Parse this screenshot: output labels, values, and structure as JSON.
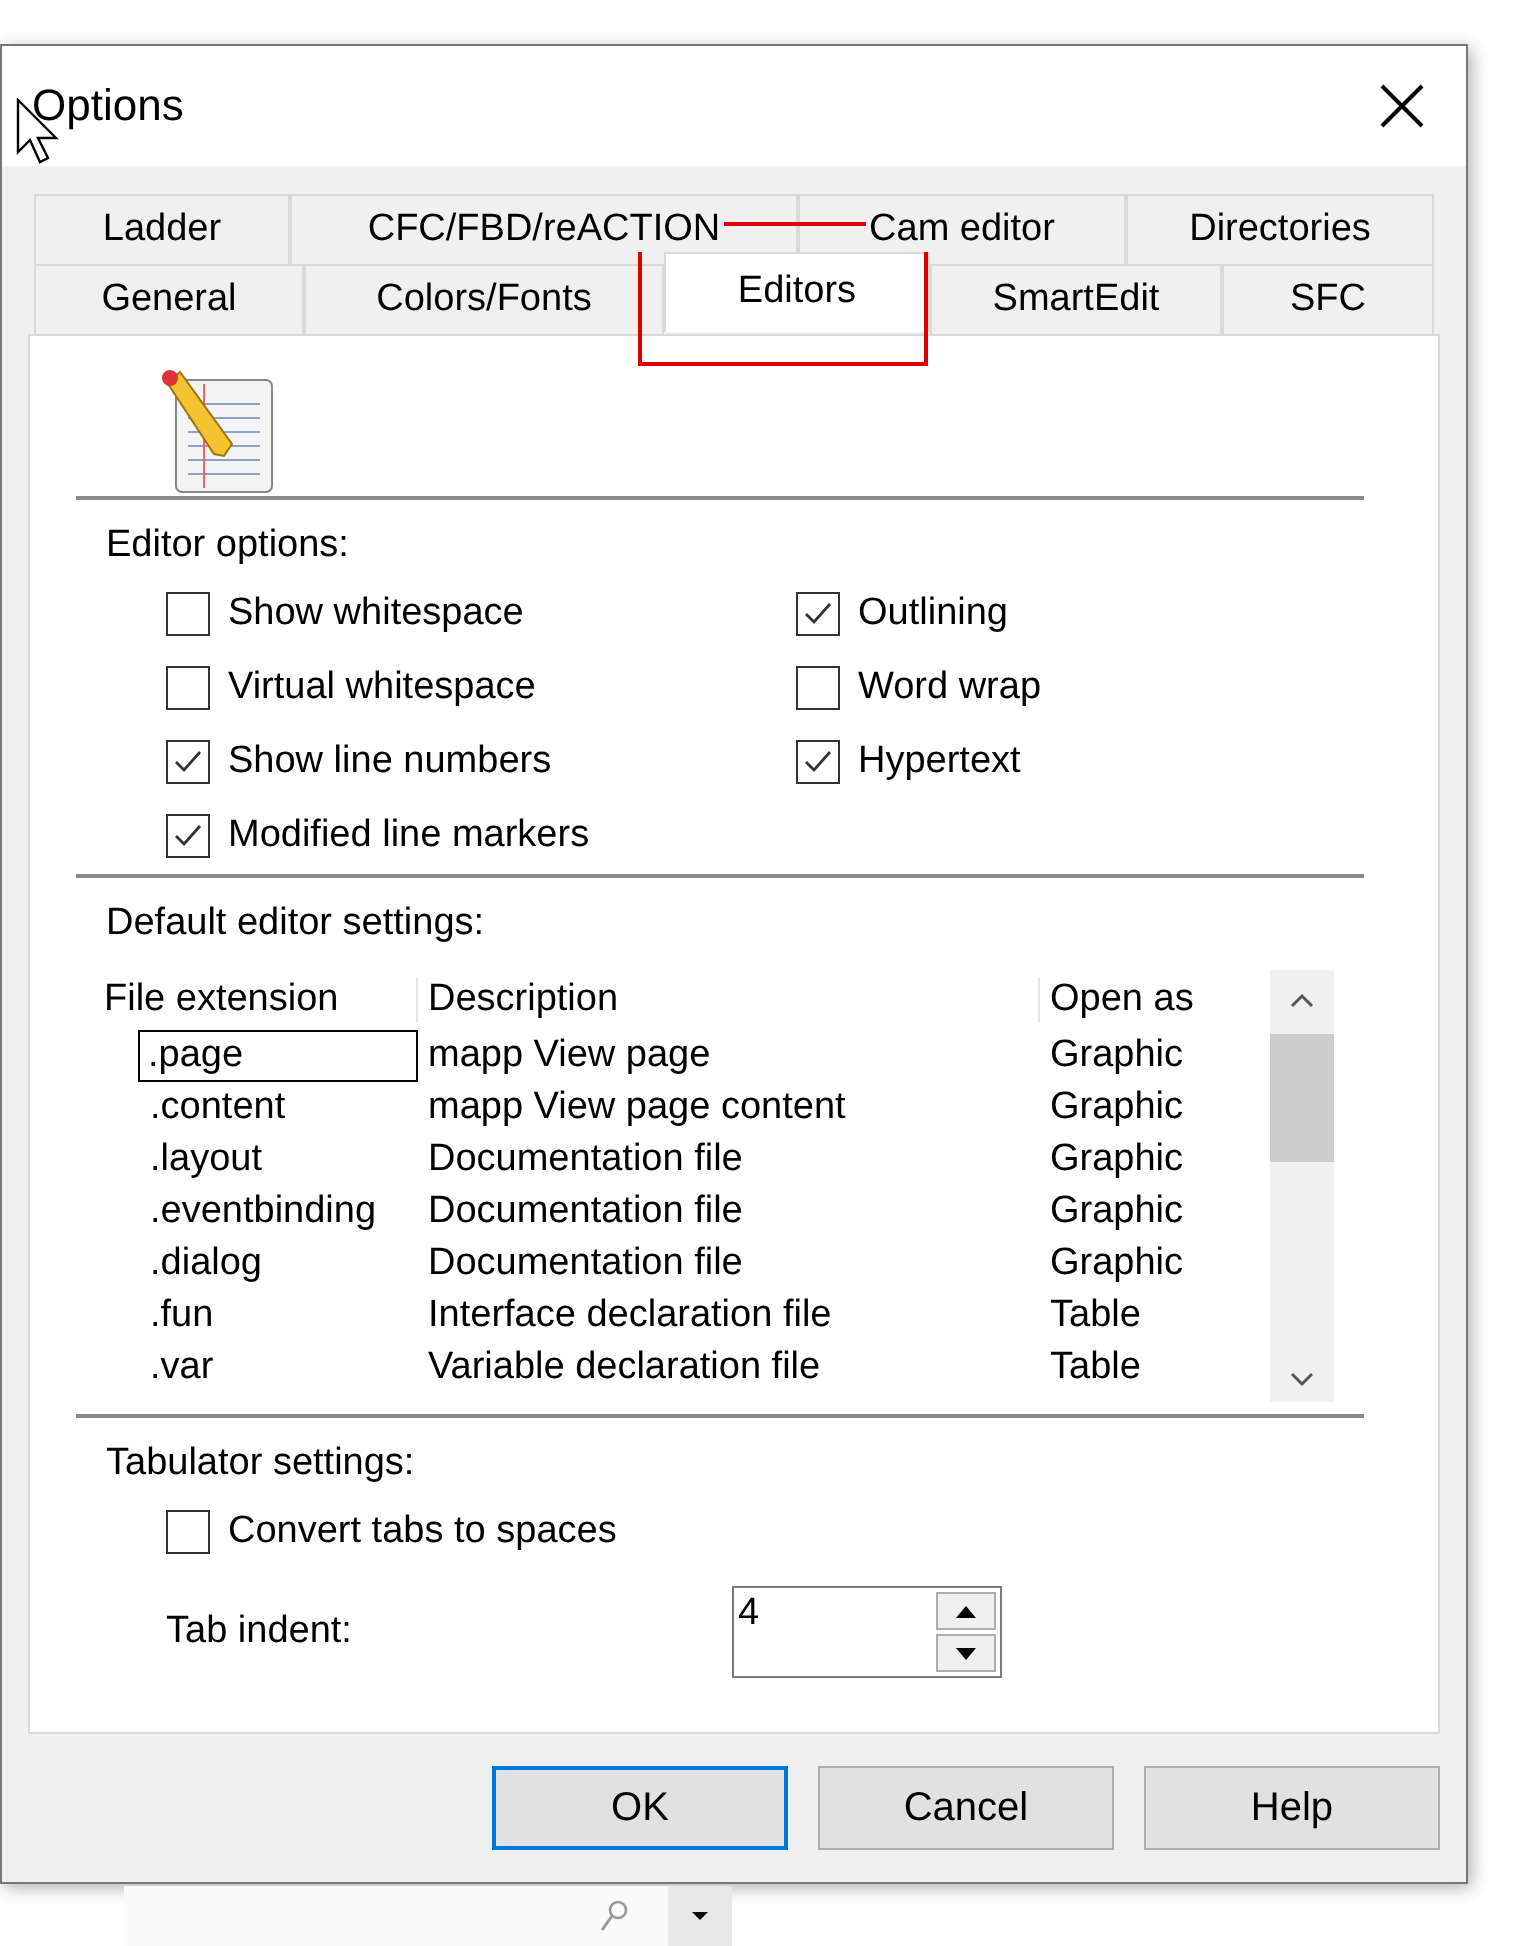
{
  "window": {
    "title": "Options"
  },
  "tab_rows": [
    [
      {
        "label": "Ladder",
        "selected": false
      },
      {
        "label": "CFC/FBD/reACTION",
        "selected": false
      },
      {
        "label": "Cam editor",
        "selected": false
      },
      {
        "label": "Directories",
        "selected": false
      }
    ],
    [
      {
        "label": "General",
        "selected": false
      },
      {
        "label": "Colors/Fonts",
        "selected": false
      },
      {
        "label": "Editors",
        "selected": true
      },
      {
        "label": "SmartEdit",
        "selected": false
      },
      {
        "label": "SFC",
        "selected": false
      }
    ]
  ],
  "editor_options": {
    "heading": "Editor options:",
    "options": [
      {
        "label": "Show whitespace",
        "checked": false
      },
      {
        "label": "Outlining",
        "checked": true
      },
      {
        "label": "Virtual whitespace",
        "checked": false
      },
      {
        "label": "Word wrap",
        "checked": false
      },
      {
        "label": "Show line numbers",
        "checked": true
      },
      {
        "label": "Hypertext",
        "checked": true
      },
      {
        "label": "Modified line markers",
        "checked": true
      }
    ]
  },
  "default_editor_settings": {
    "heading": "Default editor settings:",
    "columns": [
      "File extension",
      "Description",
      "Open as"
    ],
    "rows": [
      {
        "cells": [
          ".page",
          "mapp View page",
          "Graphic"
        ],
        "selected": true
      },
      {
        "cells": [
          ".content",
          "mapp View page content",
          "Graphic"
        ],
        "selected": false
      },
      {
        "cells": [
          ".layout",
          "Documentation file",
          "Graphic"
        ],
        "selected": false
      },
      {
        "cells": [
          ".eventbinding",
          "Documentation file",
          "Graphic"
        ],
        "selected": false
      },
      {
        "cells": [
          ".dialog",
          "Documentation file",
          "Graphic"
        ],
        "selected": false
      },
      {
        "cells": [
          ".fun",
          "Interface declaration file",
          "Table"
        ],
        "selected": false
      },
      {
        "cells": [
          ".var",
          "Variable declaration file",
          "Table"
        ],
        "selected": false
      }
    ]
  },
  "tabulator_settings": {
    "heading": "Tabulator settings:",
    "convert": {
      "label": "Convert tabs to spaces",
      "checked": false
    },
    "indent_label": "Tab indent:",
    "indent_value": "4"
  },
  "buttons": [
    {
      "label": "OK",
      "default": true
    },
    {
      "label": "Cancel",
      "default": false
    },
    {
      "label": "Help",
      "default": false
    }
  ]
}
